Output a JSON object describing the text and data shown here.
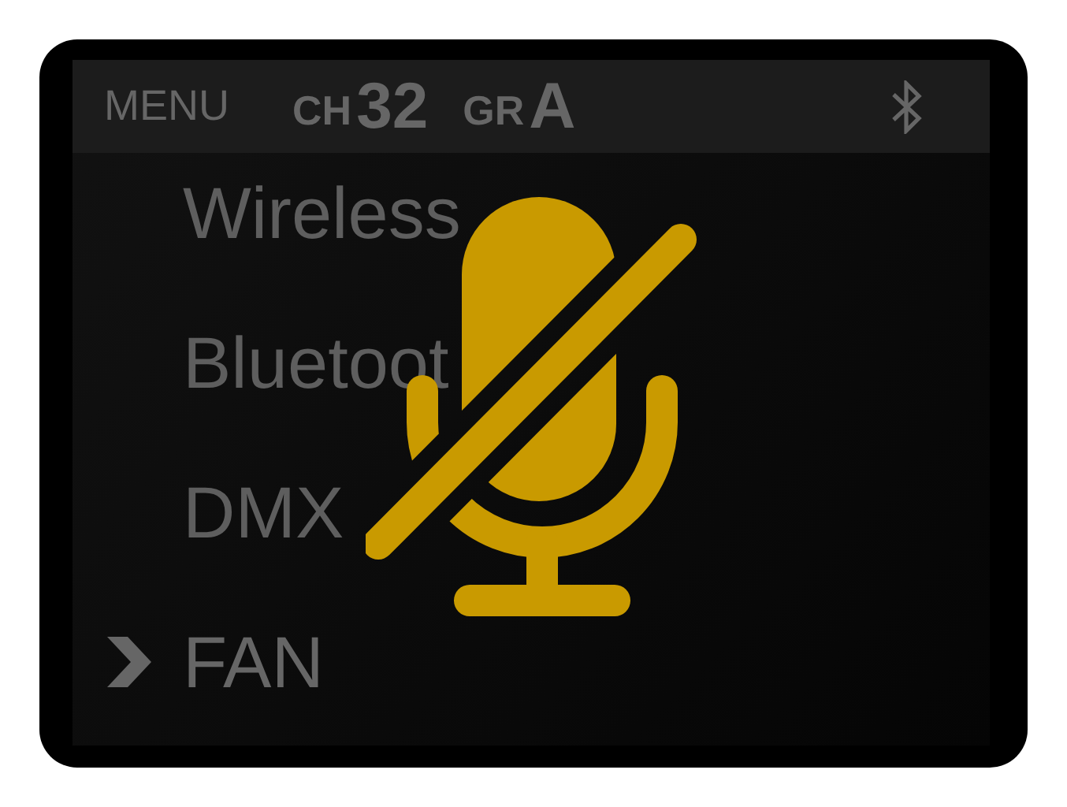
{
  "header": {
    "title": "MENU",
    "channel": {
      "label": "CH",
      "value": "32"
    },
    "group": {
      "label": "GR",
      "value": "A"
    }
  },
  "menu": {
    "items": [
      {
        "label": "Wireless",
        "selected": false
      },
      {
        "label": "Bluetoot",
        "selected": false
      },
      {
        "label": "DMX",
        "selected": false
      },
      {
        "label": "FAN",
        "selected": true
      }
    ]
  },
  "mic": {
    "muted": true
  }
}
